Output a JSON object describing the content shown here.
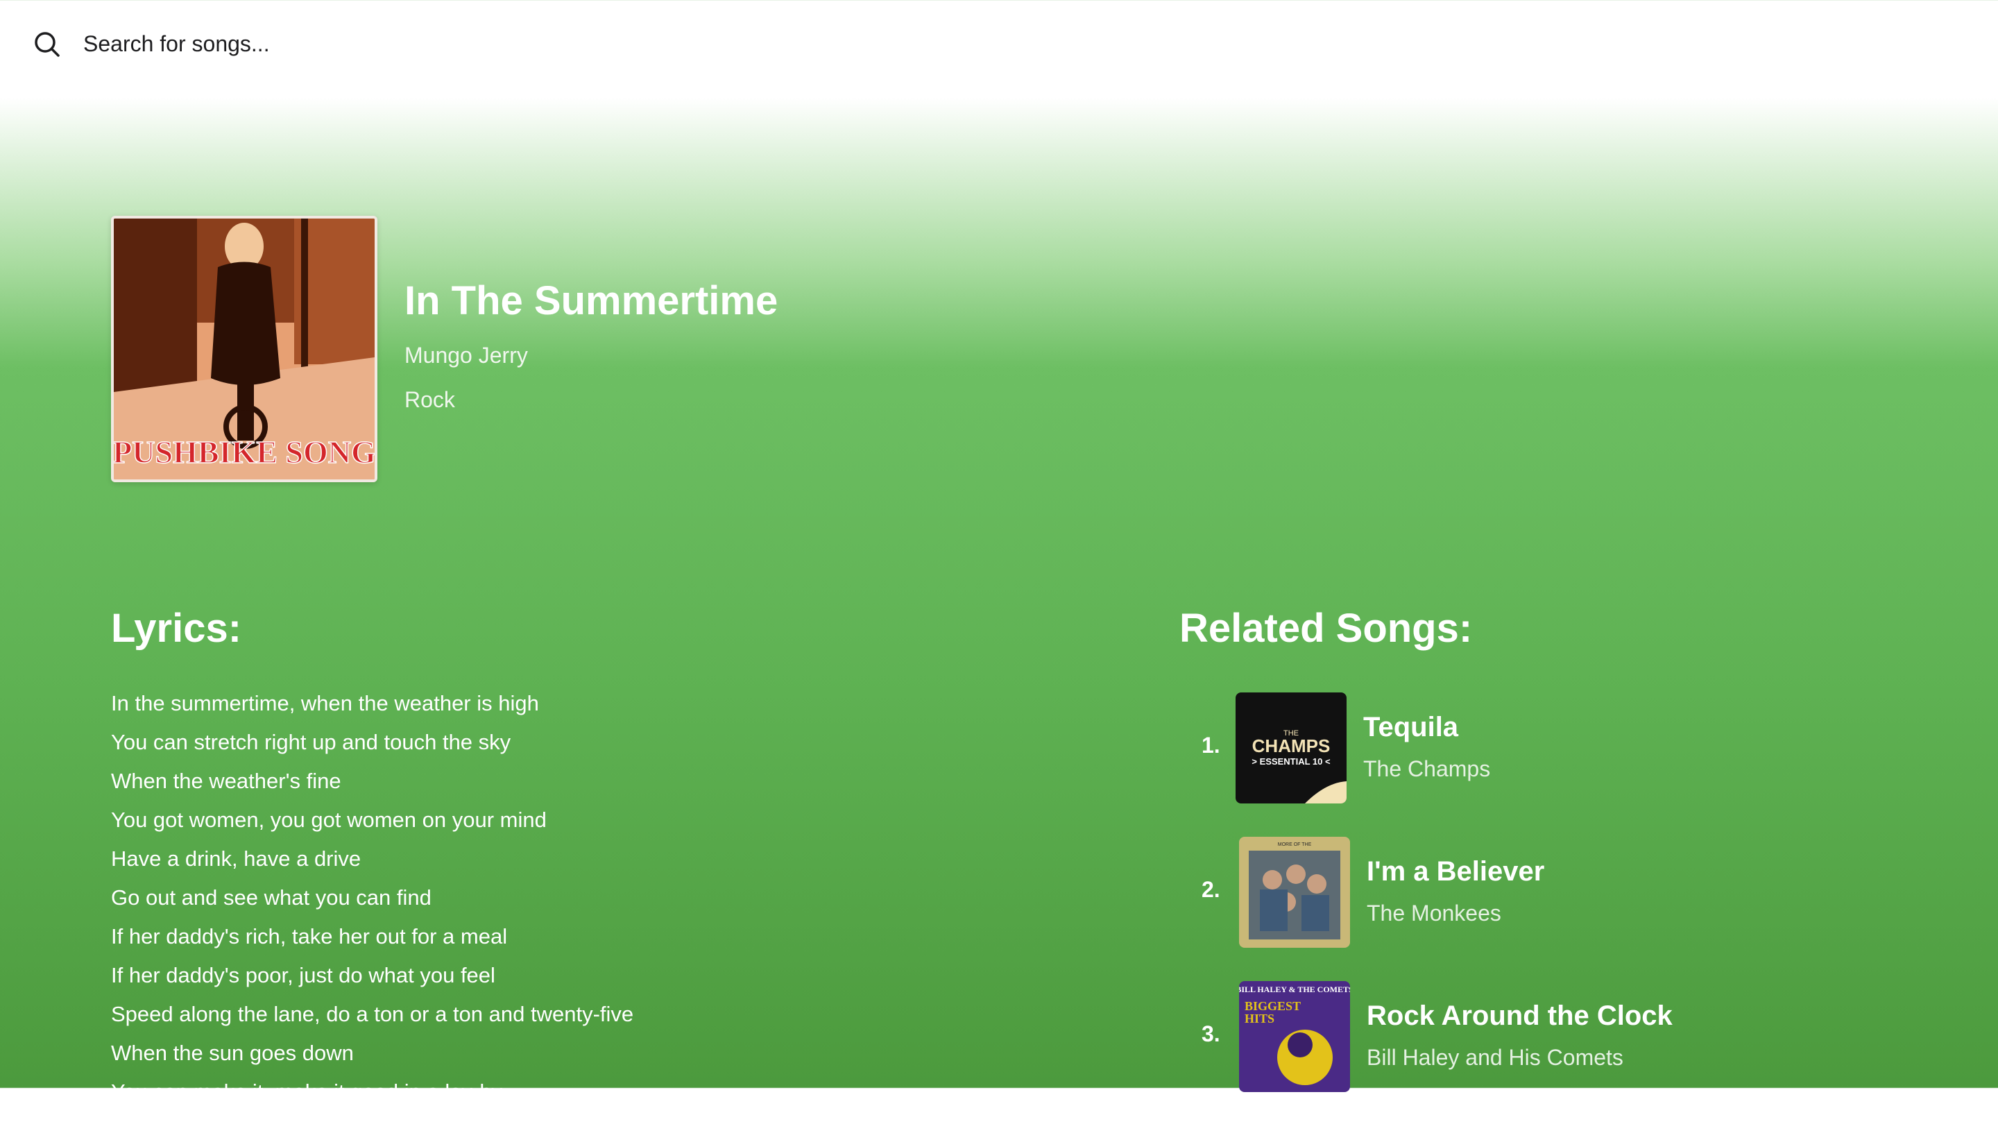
{
  "search": {
    "placeholder": "Search for songs..."
  },
  "song": {
    "title": "In The Summertime",
    "artist": "Mungo Jerry",
    "genre": "Rock",
    "cover_text": "PUSHBIKE SONG"
  },
  "lyrics": {
    "heading": "Lyrics:",
    "lines": [
      "In the summertime, when the weather is high",
      "You can stretch right up and touch the sky",
      "When the weather's fine",
      "You got women, you got women on your mind",
      "Have a drink, have a drive",
      "Go out and see what you can find",
      "If her daddy's rich, take her out for a meal",
      "If her daddy's poor, just do what you feel",
      "Speed along the lane, do a ton or a ton and twenty-five",
      "When the sun goes down",
      "You can make it, make it good in a lay-by"
    ]
  },
  "related": {
    "heading": "Related Songs:",
    "items": [
      {
        "num": "1.",
        "title": "Tequila",
        "artist": "The Champs",
        "cover_line1": "THE",
        "cover_line2": "CHAMPS",
        "cover_line3": "> ESSENTIAL 10 <"
      },
      {
        "num": "2.",
        "title": "I'm a Believer",
        "artist": "The Monkees",
        "cover_line1": "MORE OF THE"
      },
      {
        "num": "3.",
        "title": "Rock Around the Clock",
        "artist": "Bill Haley and His Comets",
        "cover_line1": "BILL HALEY & THE COMETS",
        "cover_line2": "BIGGEST",
        "cover_line3": "HITS"
      }
    ]
  },
  "colors": {
    "background_top": "#ffffff",
    "background_green": "#5eb152",
    "text_primary": "#ffffff",
    "search_text": "#1d1d1f"
  },
  "icons": {
    "search": "search-icon"
  }
}
